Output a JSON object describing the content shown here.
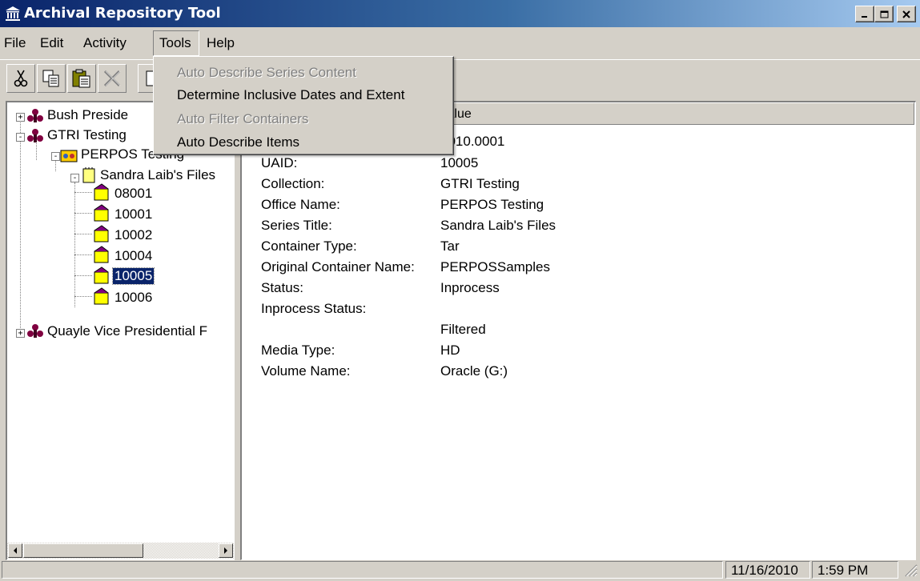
{
  "window": {
    "title": "Archival Repository Tool"
  },
  "menu": {
    "file": "File",
    "edit": "Edit",
    "activity": "Activity",
    "tools": "Tools",
    "help": "Help"
  },
  "tools_menu": {
    "items": [
      {
        "label": "Auto Describe Series Content",
        "enabled": false
      },
      {
        "label": "Determine Inclusive Dates and Extent",
        "enabled": true
      },
      {
        "label": "Auto Filter Containers",
        "enabled": false
      },
      {
        "label": "Auto Describe Items",
        "enabled": true
      }
    ]
  },
  "toolbar": {
    "icons": [
      "cut-icon",
      "copy-icon",
      "paste-icon",
      "delete-icon",
      "properties-icon"
    ]
  },
  "tree": {
    "nodes": [
      {
        "label": "Bush Preside",
        "icon": "collection-icon"
      },
      {
        "label": "GTRI Testing",
        "icon": "collection-icon"
      },
      {
        "label": "PERPOS Testing",
        "icon": "office-icon"
      },
      {
        "label": "Sandra Laib's Files",
        "icon": "series-icon"
      },
      {
        "label": "08001",
        "icon": "container-icon"
      },
      {
        "label": "10001",
        "icon": "container-icon"
      },
      {
        "label": "10002",
        "icon": "container-icon"
      },
      {
        "label": "10004",
        "icon": "container-icon"
      },
      {
        "label": "10005",
        "icon": "container-icon",
        "selected": true
      },
      {
        "label": "10006",
        "icon": "container-icon"
      },
      {
        "label": "Quayle Vice Presidential F",
        "icon": "collection-icon"
      }
    ]
  },
  "details": {
    "col_value": "Value",
    "first_value": "2010.0001",
    "rows": [
      {
        "label": "UAID:",
        "value": "10005"
      },
      {
        "label": "Collection:",
        "value": "GTRI Testing"
      },
      {
        "label": "Office Name:",
        "value": "PERPOS Testing"
      },
      {
        "label": "Series Title:",
        "value": "Sandra Laib's Files"
      },
      {
        "label": "Container Type:",
        "value": "Tar"
      },
      {
        "label": "Original Container Name:",
        "value": "PERPOSSamples"
      },
      {
        "label": "Status:",
        "value": "Inprocess"
      },
      {
        "label": "Inprocess Status:",
        "value": ""
      },
      {
        "label": "",
        "value": "Filtered"
      },
      {
        "label": "Media Type:",
        "value": "HD"
      },
      {
        "label": "Volume Name:",
        "value": "Oracle (G:)"
      }
    ]
  },
  "status": {
    "date": "11/16/2010",
    "time": "1:59 PM"
  },
  "colors": {
    "title_start": "#0a246a",
    "title_end": "#a6caf0",
    "selection": "#0a246a",
    "face": "#d4d0c8"
  }
}
